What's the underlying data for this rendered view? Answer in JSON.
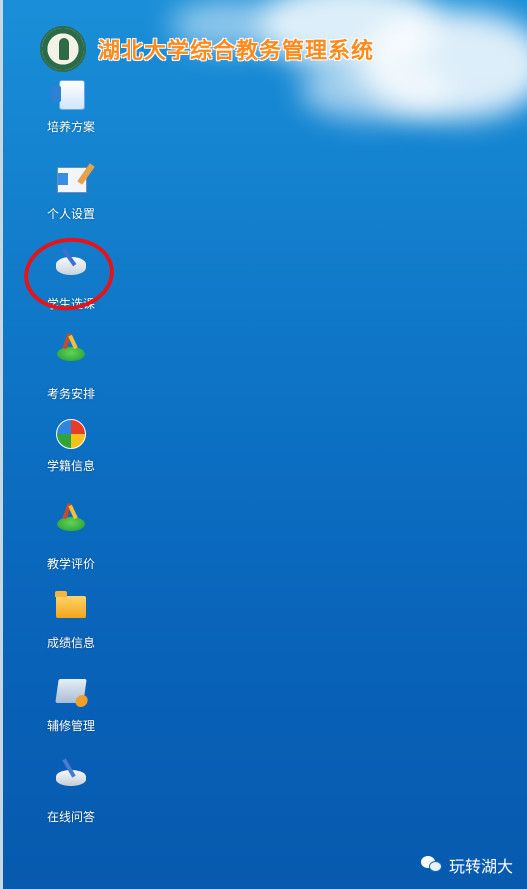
{
  "app": {
    "title": "湖北大学综合教务管理系统"
  },
  "desktop": {
    "icons": [
      {
        "label": "培养方案",
        "icon": "training-plan-icon"
      },
      {
        "label": "个人设置",
        "icon": "personal-settings-icon"
      },
      {
        "label": "学生选课",
        "icon": "course-selection-icon"
      },
      {
        "label": "考务安排",
        "icon": "exam-arrangement-icon"
      },
      {
        "label": "学籍信息",
        "icon": "student-status-icon"
      },
      {
        "label": "教学评价",
        "icon": "teaching-evaluation-icon"
      },
      {
        "label": "成绩信息",
        "icon": "grades-folder-icon"
      },
      {
        "label": "辅修管理",
        "icon": "minor-management-icon"
      },
      {
        "label": "在线问答",
        "icon": "online-qa-icon"
      }
    ],
    "highlighted": "学生选课"
  },
  "watermark": {
    "text": "玩转湖大",
    "icon": "wechat-icon"
  },
  "colors": {
    "title": "#ff8a1c",
    "highlight": "#e4141b",
    "background": "#0c6fc2"
  }
}
